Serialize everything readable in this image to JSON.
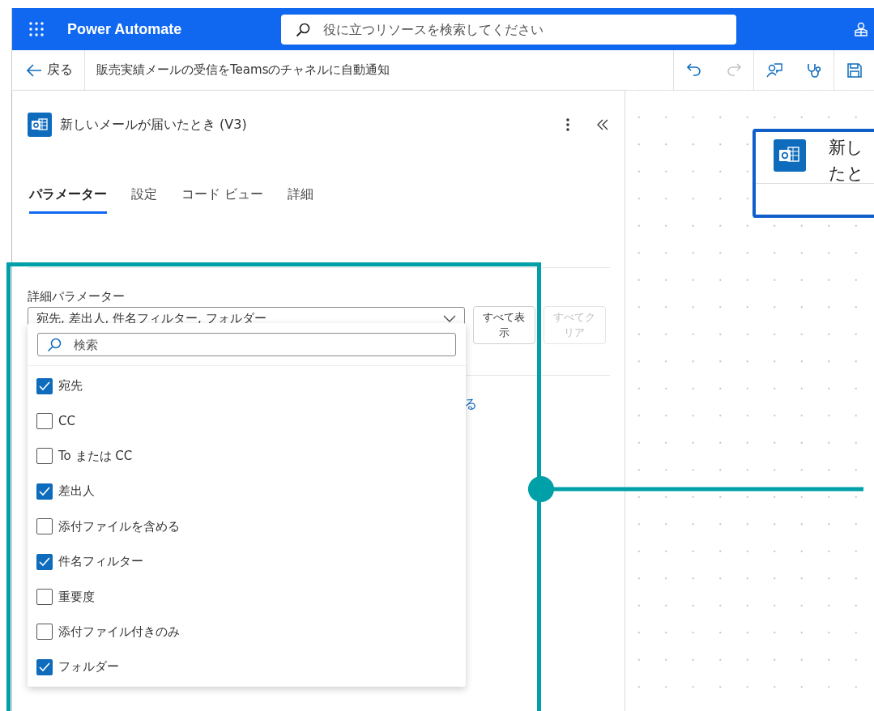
{
  "header": {
    "app_title": "Power Automate",
    "search": {
      "placeholder": "役に立つリソースを検索してください"
    }
  },
  "toolbar": {
    "back": "戻る",
    "flow_title": "販売実績メールの受信をTeamsのチャネルに自動通知",
    "tool_groups": [
      [
        {
          "kind": "undo",
          "disabled": false
        },
        {
          "kind": "redo",
          "disabled": true
        }
      ],
      [
        {
          "kind": "assistant",
          "disabled": false
        },
        {
          "kind": "checker",
          "disabled": false
        }
      ],
      [
        {
          "kind": "save",
          "disabled": false
        }
      ]
    ]
  },
  "panel": {
    "title": "新しいメールが届いたとき (V3)",
    "tabs": [
      {
        "label": "パラメーター",
        "selected": true
      },
      {
        "label": "設定",
        "selected": false
      },
      {
        "label": "コード ビュー",
        "selected": false
      },
      {
        "label": "詳細",
        "selected": false
      }
    ],
    "advanced": {
      "label": "詳細パラメーター",
      "value": "宛先, 差出人, 件名フィルター, フォルダー",
      "buttons": [
        {
          "label": "すべて表示",
          "disabled": false
        },
        {
          "label": "すべてクリア",
          "disabled": true
        }
      ],
      "link": "る",
      "dropdown": {
        "search": {
          "placeholder": "検索"
        },
        "options": [
          {
            "label": "宛先",
            "checked": true
          },
          {
            "label": "CC",
            "checked": false
          },
          {
            "label": "To または CC",
            "checked": false
          },
          {
            "label": "差出人",
            "checked": true
          },
          {
            "label": "添付ファイルを含める",
            "checked": false
          },
          {
            "label": "件名フィルター",
            "checked": true
          },
          {
            "label": "重要度",
            "checked": false
          },
          {
            "label": "添付ファイル付きのみ",
            "checked": false
          },
          {
            "label": "フォルダー",
            "checked": true
          }
        ]
      }
    }
  },
  "canvas": {
    "node": {
      "title_lines": [
        "新し",
        "たと"
      ],
      "selected": true
    }
  }
}
